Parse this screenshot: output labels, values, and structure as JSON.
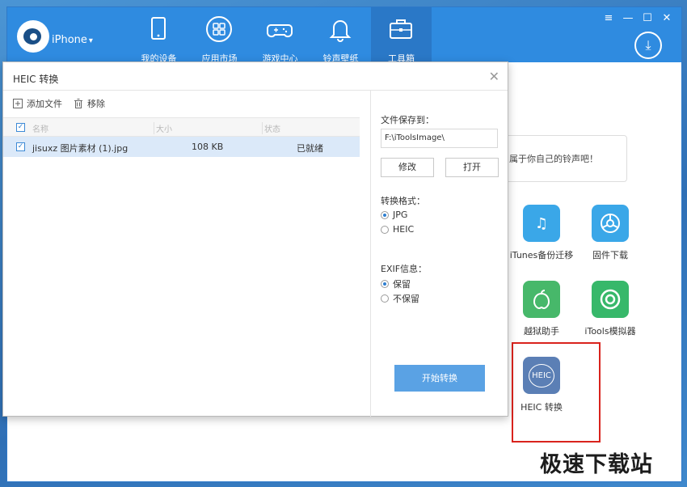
{
  "app": {
    "device_name": "iPhone",
    "nav": [
      {
        "label": "我的设备",
        "icon": "tablet-icon"
      },
      {
        "label": "应用市场",
        "icon": "apps-grid-icon"
      },
      {
        "label": "游戏中心",
        "icon": "gamepad-icon"
      },
      {
        "label": "铃声壁纸",
        "icon": "bell-icon"
      },
      {
        "label": "工具箱",
        "icon": "toolbox-icon"
      }
    ],
    "active_nav": "工具箱",
    "window_controls": [
      "≡",
      "—",
      "☐",
      "✕"
    ],
    "download_icon": "download-icon",
    "ringtone_promo": "属于你自己的铃声吧！",
    "tools": [
      {
        "label": "iTunes备份迁移",
        "icon": "music-note-icon",
        "color": "#3aa7e8"
      },
      {
        "label": "固件下载",
        "icon": "firmware-icon",
        "color": "#3aa7e8"
      },
      {
        "label": "越狱助手",
        "icon": "jailbreak-icon",
        "color": "#47b86a"
      },
      {
        "label": "iTools模拟器",
        "icon": "simulator-icon",
        "color": "#37b86a"
      },
      {
        "label": "HEIC 转换",
        "icon": "heic-icon",
        "color": "#5b7fb5",
        "icon_text": "HEIC"
      }
    ]
  },
  "dialog": {
    "title": "HEIC 转换",
    "close": "✕",
    "toolbar": {
      "add_label": "添加文件",
      "remove_label": "移除"
    },
    "columns": [
      "名称",
      "大小",
      "状态"
    ],
    "files": [
      {
        "name": "jisuxz 图片素材 (1).jpg",
        "size": "108 KB",
        "status": "已就绪",
        "checked": true
      }
    ],
    "save_to_label": "文件保存到：",
    "save_path": "F:\\iToolsImage\\",
    "modify_label": "修改",
    "open_label": "打开",
    "format_label": "转换格式：",
    "formats": [
      {
        "label": "JPG",
        "selected": true
      },
      {
        "label": "HEIC",
        "selected": false
      }
    ],
    "exif_label": "EXIF信息：",
    "exif_options": [
      {
        "label": "保留",
        "selected": true
      },
      {
        "label": "不保留",
        "selected": false
      }
    ],
    "start_label": "开始转换"
  },
  "watermark": "极速下载站",
  "colors": {
    "accent": "#2f8be0",
    "button": "#5aa2e4",
    "highlight": "#d9231d"
  }
}
